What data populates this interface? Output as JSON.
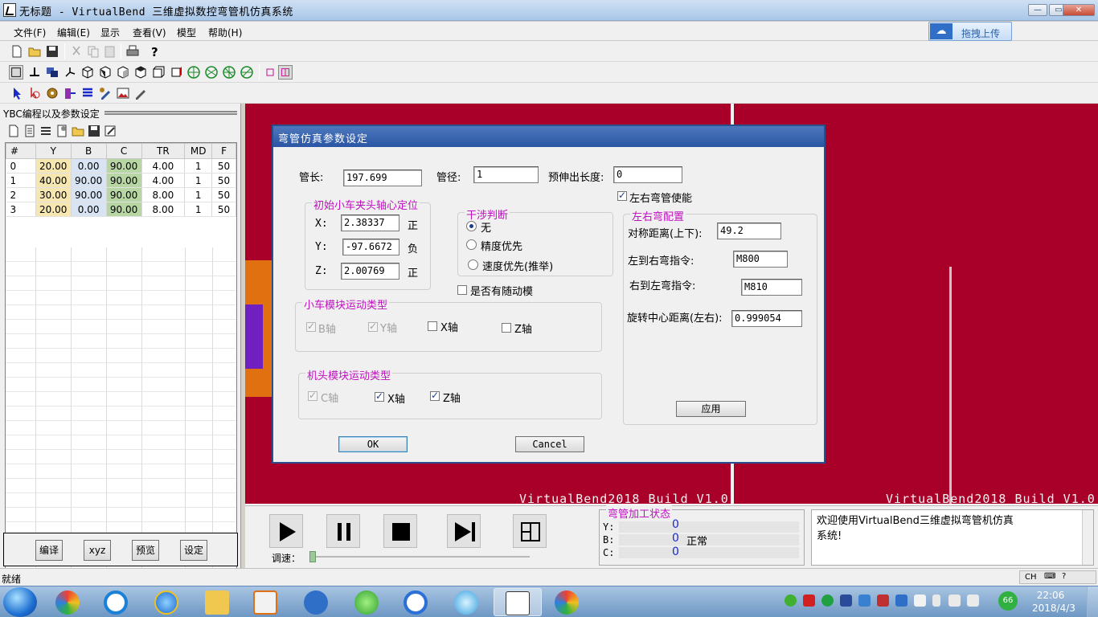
{
  "window": {
    "title": "无标题 - VirtualBend   三维虚拟数控弯管机仿真系统",
    "controls": [
      "—",
      "▭",
      "✕"
    ]
  },
  "menu": [
    "文件(F)",
    "编辑(E)",
    "显示",
    "查看(V)",
    "模型",
    "帮助(H)"
  ],
  "upload_button": "拖拽上传",
  "left_panel": {
    "title": "YBC编程以及参数设定",
    "columns": [
      "#",
      "Y",
      "B",
      "C",
      "TR",
      "MD",
      "F"
    ],
    "rows": [
      [
        "0",
        "20.00",
        "0.00",
        "90.00",
        "4.00",
        "1",
        "50"
      ],
      [
        "1",
        "40.00",
        "90.00",
        "90.00",
        "4.00",
        "1",
        "50"
      ],
      [
        "2",
        "30.00",
        "90.00",
        "90.00",
        "8.00",
        "1",
        "50"
      ],
      [
        "3",
        "20.00",
        "0.00",
        "90.00",
        "8.00",
        "1",
        "50"
      ]
    ],
    "buttons": [
      "编译",
      "xyz",
      "预览",
      "设定"
    ]
  },
  "viewport": {
    "build_label_1": "VirtualBend2018 Build V1.0",
    "build_label_2": "VirtualBend2018 Build V1.0"
  },
  "controls_panel": {
    "speed_label": "调速：",
    "speed_value": 0.0,
    "status_title": "弯管加工状态",
    "status_rows": [
      {
        "axis": "Y:",
        "value": "0",
        "note": ""
      },
      {
        "axis": "B:",
        "value": "0",
        "note": "正常"
      },
      {
        "axis": "C:",
        "value": "0",
        "note": ""
      }
    ],
    "message": "欢迎使用VirtualBend三维虚拟弯管机仿真系统!"
  },
  "statusbar": {
    "text": "就绪",
    "ime": "CH"
  },
  "dialog": {
    "title": "弯管仿真参数设定",
    "pipe_length_label": "管长:",
    "pipe_length": "197.699",
    "pipe_diameter_label": "管径:",
    "pipe_diameter": "1",
    "pre_extend_label": "预伸出长度:",
    "pre_extend": "0",
    "lr_bend_enable_label": "左右弯管使能",
    "lr_bend_enable": true,
    "init_group": {
      "title": "初始小车夹头轴心定位",
      "x_label": "X:",
      "x_value": "2.38337",
      "x_sign": "正",
      "y_label": "Y:",
      "y_value": "-97.6672",
      "y_sign": "负",
      "z_label": "Z:",
      "z_value": "2.00769",
      "z_sign": "正"
    },
    "interference_group": {
      "title": "干涉判断",
      "options": [
        "无",
        "精度优先",
        "速度优先(推举)"
      ],
      "selected": 0
    },
    "follow_label": "是否有随动模",
    "follow_checked": false,
    "carriage_group": {
      "title": "小车模块运动类型",
      "items": [
        {
          "label": "B轴",
          "checked": true,
          "disabled": true
        },
        {
          "label": "Y轴",
          "checked": true,
          "disabled": true
        },
        {
          "label": "X轴",
          "checked": false,
          "disabled": false
        },
        {
          "label": "Z轴",
          "checked": false,
          "disabled": false
        }
      ]
    },
    "head_group": {
      "title": "机头模块运动类型",
      "items": [
        {
          "label": "C轴",
          "checked": true,
          "disabled": true
        },
        {
          "label": "X轴",
          "checked": true,
          "disabled": false
        },
        {
          "label": "Z轴",
          "checked": true,
          "disabled": false
        }
      ]
    },
    "lr_group": {
      "title": "左右弯配置",
      "sym_label": "对称距离(上下):",
      "sym_value": "49.2",
      "l2r_label": "左到右弯指令:",
      "l2r_value": "M800",
      "r2l_label": "右到左弯指令:",
      "r2l_value": "M810",
      "rot_label": "旋转中心距离(左右):",
      "rot_value": "0.999054",
      "apply_label": "应用"
    },
    "ok_label": "OK",
    "cancel_label": "Cancel"
  },
  "taskbar": {
    "time": "22:06",
    "date": "2018/4/3",
    "battery_badge": "66"
  }
}
